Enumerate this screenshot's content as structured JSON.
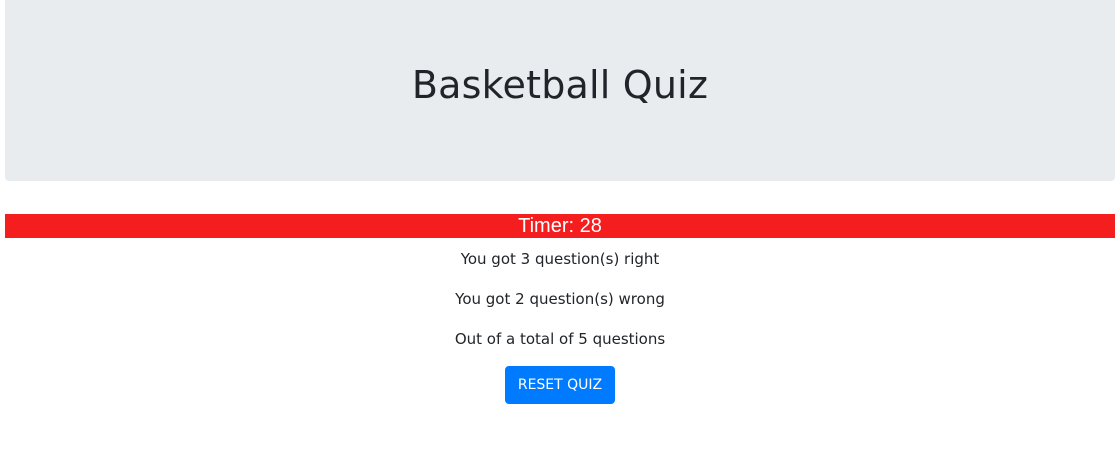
{
  "header": {
    "title": "Basketball Quiz"
  },
  "timer": {
    "label": "Timer: 28",
    "color": "#f51e1e"
  },
  "results": {
    "right": "You got 3 question(s) right",
    "wrong": "You got 2 question(s) wrong",
    "total": "Out of a total of 5 questions"
  },
  "actions": {
    "reset_label": "RESET QUIZ",
    "reset_color": "#007bff"
  }
}
